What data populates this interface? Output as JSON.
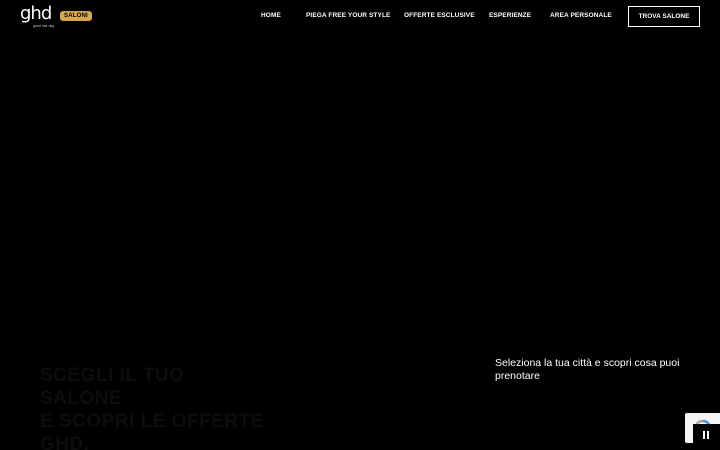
{
  "header": {
    "logo_text": "ghd",
    "logo_tagline": "good hair day",
    "badge": "SALONI",
    "nav": [
      {
        "label": "HOME"
      },
      {
        "label": "PIEGA FREE YOUR STYLE"
      },
      {
        "label": "OFFERTE ESCLUSIVE"
      },
      {
        "label": "ESPERIENZE"
      },
      {
        "label": "AREA PERSONALE"
      }
    ],
    "cta_label": "TROVA SALONE"
  },
  "hero": {
    "title_lines": [
      "SCEGLI IL TUO SALONE",
      "E SCOPRI LE OFFERTE",
      "GHD."
    ],
    "subtitle": "Seleziona la tua città e scopri cosa puoi prenotare"
  },
  "colors": {
    "background": "#000000",
    "badge": "#d7a64c",
    "text": "#ffffff"
  },
  "icons": {
    "recaptcha": "recaptcha-icon",
    "pause": "pause-icon"
  }
}
